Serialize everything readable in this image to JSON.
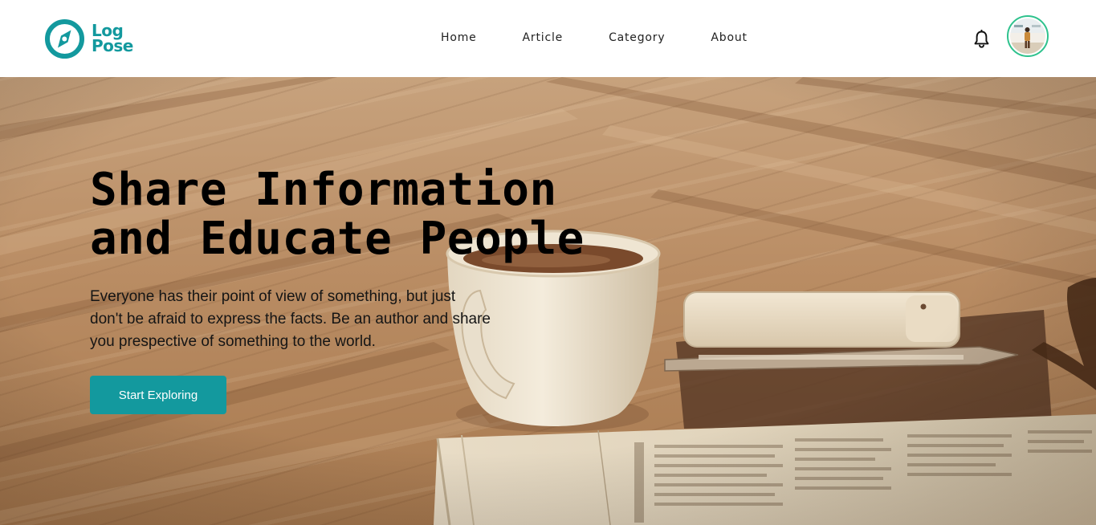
{
  "header": {
    "logo": {
      "line1": "Log",
      "line2": "Pose"
    },
    "nav": [
      {
        "label": "Home"
      },
      {
        "label": "Article"
      },
      {
        "label": "Category"
      },
      {
        "label": "About"
      }
    ],
    "icons": {
      "notification": "bell-icon",
      "profile": "avatar"
    }
  },
  "hero": {
    "title_line1": "Share Information",
    "title_line2": "and Educate People",
    "description": "Everyone has their point of view of something, but just don't be afraid to express the facts. Be an author and share you prespective of something to the world.",
    "cta_label": "Start Exploring"
  },
  "colors": {
    "brand": "#13999e",
    "avatar_ring": "#2ec28d",
    "text": "#151515"
  }
}
